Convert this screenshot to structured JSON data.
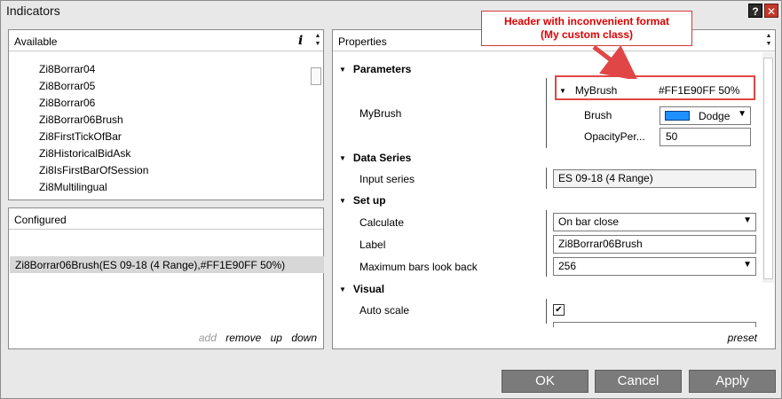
{
  "window": {
    "title": "Indicators",
    "help_label": "?",
    "close_label": "✕"
  },
  "available": {
    "header": "Available",
    "info_label": "i",
    "items": [
      "Zi8Borrar04",
      "Zi8Borrar05",
      "Zi8Borrar06",
      "Zi8Borrar06Brush",
      "Zi8FirstTickOfBar",
      "Zi8HistoricalBidAsk",
      "Zi8IsFirstBarOfSession",
      "Zi8Multilingual"
    ]
  },
  "configured": {
    "header": "Configured",
    "items": [
      "Zi8Borrar06Brush(ES 09-18 (4 Range),#FF1E90FF 50%)"
    ],
    "actions": {
      "add": "add",
      "remove": "remove",
      "up": "up",
      "down": "down"
    }
  },
  "properties": {
    "header": "Properties",
    "parameters": {
      "title": "Parameters",
      "mybrush_label": "MyBrush",
      "sub_header_label": "MyBrush",
      "sub_header_value": "#FF1E90FF 50%",
      "brush_label": "Brush",
      "brush_value": "Dodge",
      "brush_color": "#1E90FF",
      "opacity_label": "OpacityPer...",
      "opacity_value": "50"
    },
    "data_series": {
      "title": "Data Series",
      "input_label": "Input series",
      "input_value": "ES 09-18 (4 Range)"
    },
    "setup": {
      "title": "Set up",
      "calculate_label": "Calculate",
      "calculate_value": "On bar close",
      "label_label": "Label",
      "label_value": "Zi8Borrar06Brush",
      "maxbars_label": "Maximum bars look back",
      "maxbars_value": "256"
    },
    "visual": {
      "title": "Visual",
      "autoscale_label": "Auto scale",
      "autoscale_checked": true
    },
    "preset": "preset"
  },
  "annotation": {
    "line1": "Header with inconvenient format",
    "line2": "(My custom class)",
    "color": "#E04646"
  },
  "buttons": {
    "ok": "OK",
    "cancel": "Cancel",
    "apply": "Apply"
  }
}
